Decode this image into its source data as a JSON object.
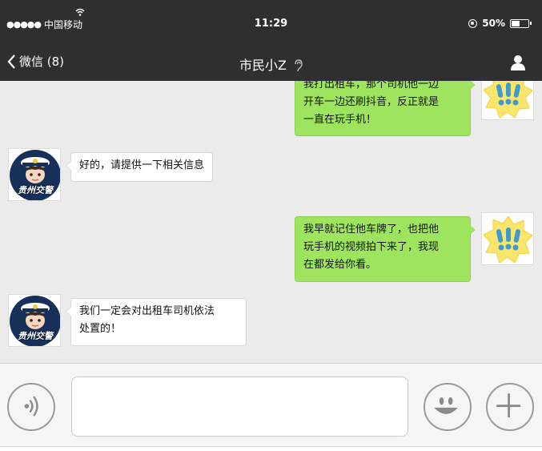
{
  "status_bar": {
    "signal": "●●●●●",
    "carrier": "中国移动",
    "time": "11:29",
    "battery_text": "50%",
    "battery_level": 0.5
  },
  "nav": {
    "back_label": "微信 (8)",
    "title": "市民小Z"
  },
  "messages": [
    {
      "side": "me",
      "text_lines": [
        "我打出租车，那个司机他一边",
        "开车一边还刷抖音，反正就是",
        "一直在玩手机！"
      ]
    },
    {
      "side": "them",
      "text_lines": [
        "好的，请提供一下相关信息"
      ]
    },
    {
      "side": "me",
      "text_lines": [
        "我早就记住他车牌了，也把他",
        "玩手机的视频拍下来了，我现",
        "在都发给你看。"
      ]
    },
    {
      "side": "them",
      "text_lines": [
        "我们一定会对出租车司机依法",
        "处置的！"
      ]
    }
  ],
  "avatars": {
    "them_label": "贵州交警"
  },
  "input": {
    "value": ""
  },
  "colors": {
    "bar_bg": "#2f2f31",
    "chat_bg": "#ebebeb",
    "my_bubble": "#9ee45f",
    "their_bubble": "#ffffff"
  }
}
